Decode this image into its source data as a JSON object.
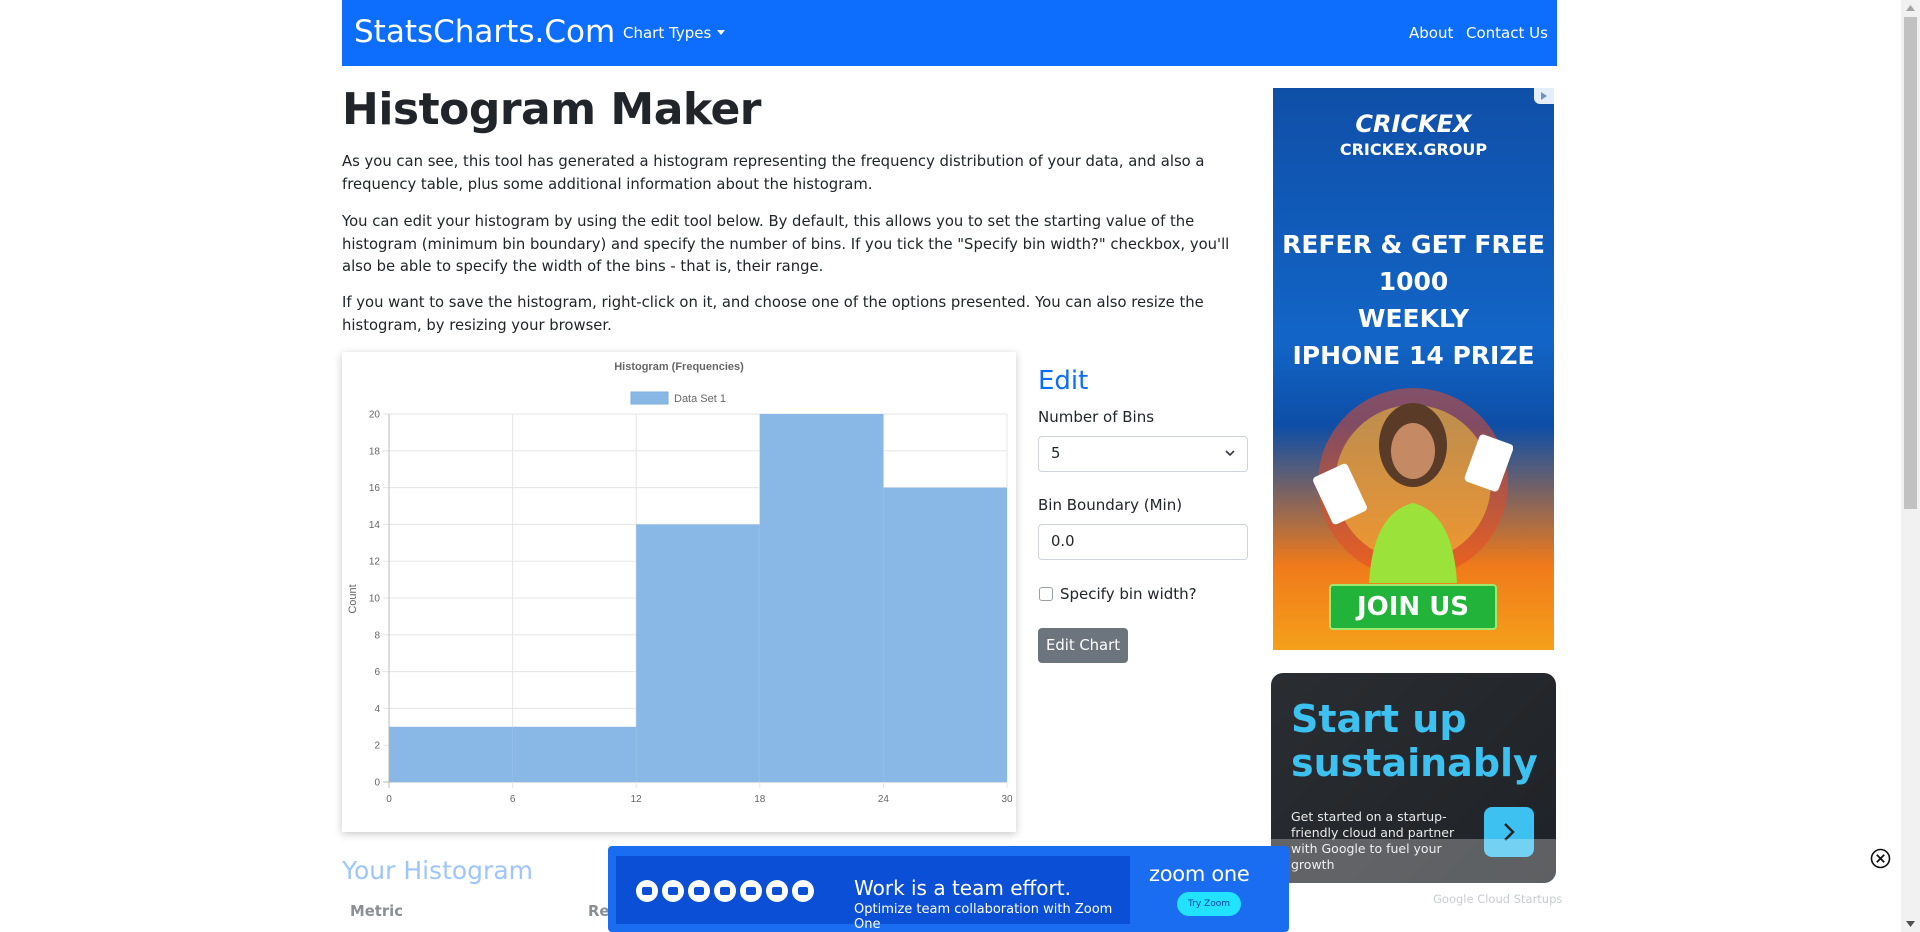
{
  "navbar": {
    "brand": "StatsCharts.Com",
    "dropdown_label": "Chart Types",
    "about": "About",
    "contact": "Contact Us"
  },
  "page": {
    "title": "Histogram Maker",
    "paragraphs": [
      "As you can see, this tool has generated a histogram representing the frequency distribution of your data, and also a frequency table, plus some additional information about the histogram.",
      "You can edit your histogram by using the edit tool below. By default, this allows you to set the starting value of the histogram (minimum bin boundary) and specify the number of bins. If you tick the \"Specify bin width?\" checkbox, you'll also be able to specify the width of the bins - that is, their range.",
      "If you want to save the histogram, right-click on it, and choose one of the options presented. You can also resize the histogram, by resizing your browser."
    ],
    "your_histogram": "Your Histogram",
    "table_headers": [
      "Metric",
      "Re"
    ]
  },
  "edit": {
    "title": "Edit",
    "bins_label": "Number of Bins",
    "bins_value": "5",
    "min_label": "Bin Boundary (Min)",
    "min_value": "0.0",
    "bin_width_label": "Specify bin width?",
    "bin_width_checked": false,
    "button": "Edit Chart"
  },
  "chart_data": {
    "type": "bar",
    "title": "Histogram (Frequencies)",
    "ylabel": "Count",
    "xlabel": "",
    "series": [
      {
        "name": "Data Set 1",
        "color": "#8ab8e6"
      }
    ],
    "bins": [
      {
        "from": 0,
        "to": 6,
        "count": 3
      },
      {
        "from": 6,
        "to": 12,
        "count": 3
      },
      {
        "from": 12,
        "to": 18,
        "count": 14
      },
      {
        "from": 18,
        "to": 24,
        "count": 20
      },
      {
        "from": 24,
        "to": 30,
        "count": 16
      }
    ],
    "x_ticks": [
      "0",
      "6",
      "12",
      "18",
      "24",
      "30"
    ],
    "y_ticks": [
      "0",
      "2",
      "4",
      "6",
      "8",
      "10",
      "12",
      "14",
      "16",
      "18",
      "20"
    ],
    "ylim": [
      0,
      20
    ],
    "xlim": [
      0,
      30
    ],
    "grid": true,
    "legend_position": "top"
  },
  "ads": {
    "crickex": {
      "logo": "CRICKEX",
      "site": "CRICKEX.GROUP",
      "headline": [
        "REFER & GET FREE 1000",
        "WEEKLY",
        "IPHONE 14 PRIZE"
      ],
      "cta": "JOIN US"
    },
    "google_cloud": {
      "headline": [
        "Start up",
        "sustainably"
      ],
      "text": "Get started on a startup-friendly cloud and partner with Google to fuel your growth",
      "footer": "Google Cloud Startups"
    },
    "zoom": {
      "headline": "Work is a team effort.",
      "subline": "Optimize team collaboration with Zoom One",
      "logo": "zoom one",
      "cta": "Try Zoom"
    }
  },
  "colors": {
    "primary": "#0d6efd",
    "bar_fill": "#8ab8e6",
    "button_gray": "#6c757d"
  }
}
